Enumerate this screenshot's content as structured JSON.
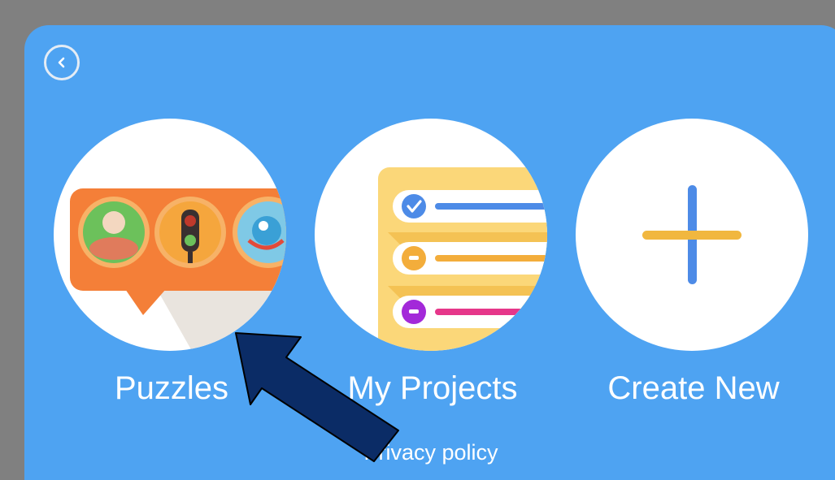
{
  "menu": {
    "back_label": "",
    "tiles": [
      {
        "id": "puzzles",
        "label": "Puzzles"
      },
      {
        "id": "my-projects",
        "label": "My Projects"
      },
      {
        "id": "create-new",
        "label": "Create New"
      }
    ]
  },
  "footer": {
    "privacy_label": "Privacy policy"
  },
  "colors": {
    "background": "#808080",
    "panel": "#4ea3f2",
    "arrow_fill": "#0b2c66",
    "puzzle_orange": "#f47f38",
    "projects_yellow": "#fbd779",
    "plus_blue": "#4d8be7",
    "plus_yellow": "#f1b73f"
  },
  "icons": {
    "back": "chevron-left-icon",
    "puzzles": "puzzle-speech-bubble-icon",
    "projects": "checklist-icon",
    "create": "plus-icon",
    "arrow": "pointer-arrow"
  }
}
